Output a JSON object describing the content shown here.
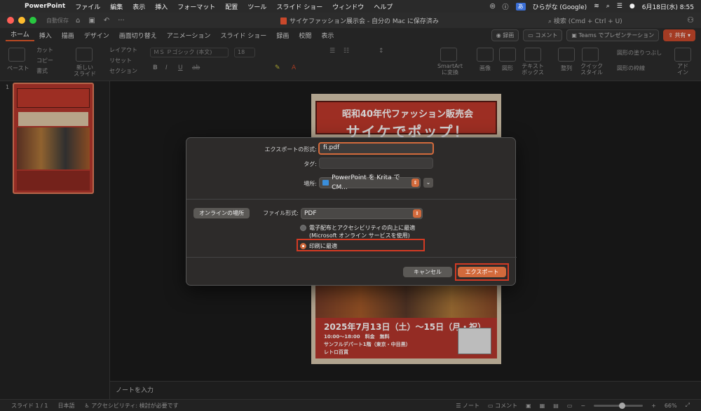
{
  "menubar": {
    "app": "PowerPoint",
    "items": [
      "ファイル",
      "編集",
      "表示",
      "挿入",
      "フォーマット",
      "配置",
      "ツール",
      "スライド ショー",
      "ウィンドウ",
      "ヘルプ"
    ],
    "ime_badge": "あ",
    "ime": "ひらがな (Google)",
    "datetime": "6月18日(水) 8:55"
  },
  "titlebar": {
    "autosave": "自動保存",
    "doc_title": "サイケファッション展示会 - 自分の Mac に保存済み",
    "search_placeholder": "検索 (Cmd + Ctrl + U)"
  },
  "ribbon_tabs": [
    "ホーム",
    "挿入",
    "描画",
    "デザイン",
    "画面切り替え",
    "アニメーション",
    "スライド ショー",
    "録画",
    "校閲",
    "表示"
  ],
  "ribbon_actions": {
    "record": "録画",
    "comment": "コメント",
    "teams": "Teams でプレゼンテーション",
    "share": "共有"
  },
  "ribbon": {
    "paste": "ペースト",
    "cut": "カット",
    "copy": "コピー",
    "format": "書式",
    "new_slide": "新しい\nスライド",
    "layout": "レイアウト",
    "reset": "リセット",
    "section": "セクション",
    "font": "ＭＳ Ｐゴシック (本文)",
    "size": "18",
    "smartart": "SmartArt\nに変換",
    "picture": "画像",
    "shapes": "図形",
    "textbox": "テキスト\nボックス",
    "arrange": "整列",
    "quick_styles": "クイック\nスタイル",
    "shape_fill": "図形の塗りつぶし",
    "shape_outline": "図形の枠線",
    "addins": "アド\nイン"
  },
  "thumbnails": {
    "number": "1"
  },
  "slide": {
    "headline": "昭和40年代ファッション販売会",
    "title": "サイケでポップ！",
    "date": "2025年7月13日（土）〜15日（月・祝）",
    "time": "10:00〜18:00　料金　無料",
    "place": "サンフルデパート1階（東京・中目黒）",
    "org": "レトロ百貨"
  },
  "dialog": {
    "export_as_label": "エクスポートの形式:",
    "export_as_value": "fi.pdf",
    "tags_label": "タグ:",
    "tags_value": "",
    "where_label": "場所:",
    "where_value": "PowerPoint を Krita でCM...",
    "online_button": "オンラインの場所",
    "file_format_label": "ファイル形式:",
    "file_format_value": "PDF",
    "option1_line1": "電子配布とアクセシビリティの向上に最適",
    "option1_line2": "(Microsoft オンライン サービスを使用)",
    "option2": "印刷に最適",
    "cancel": "キャンセル",
    "export": "エクスポート"
  },
  "notes": {
    "placeholder": "ノートを入力"
  },
  "statusbar": {
    "slide": "スライド 1 / 1",
    "lang": "日本語",
    "accessibility": "アクセシビリティ: 検討が必要です",
    "notes": "ノート",
    "comments": "コメント",
    "zoom": "66%",
    "zoom_level": 0.66
  },
  "colors": {
    "accent": "#d26a3c",
    "highlight": "#d23a24",
    "share": "#c9482b"
  }
}
